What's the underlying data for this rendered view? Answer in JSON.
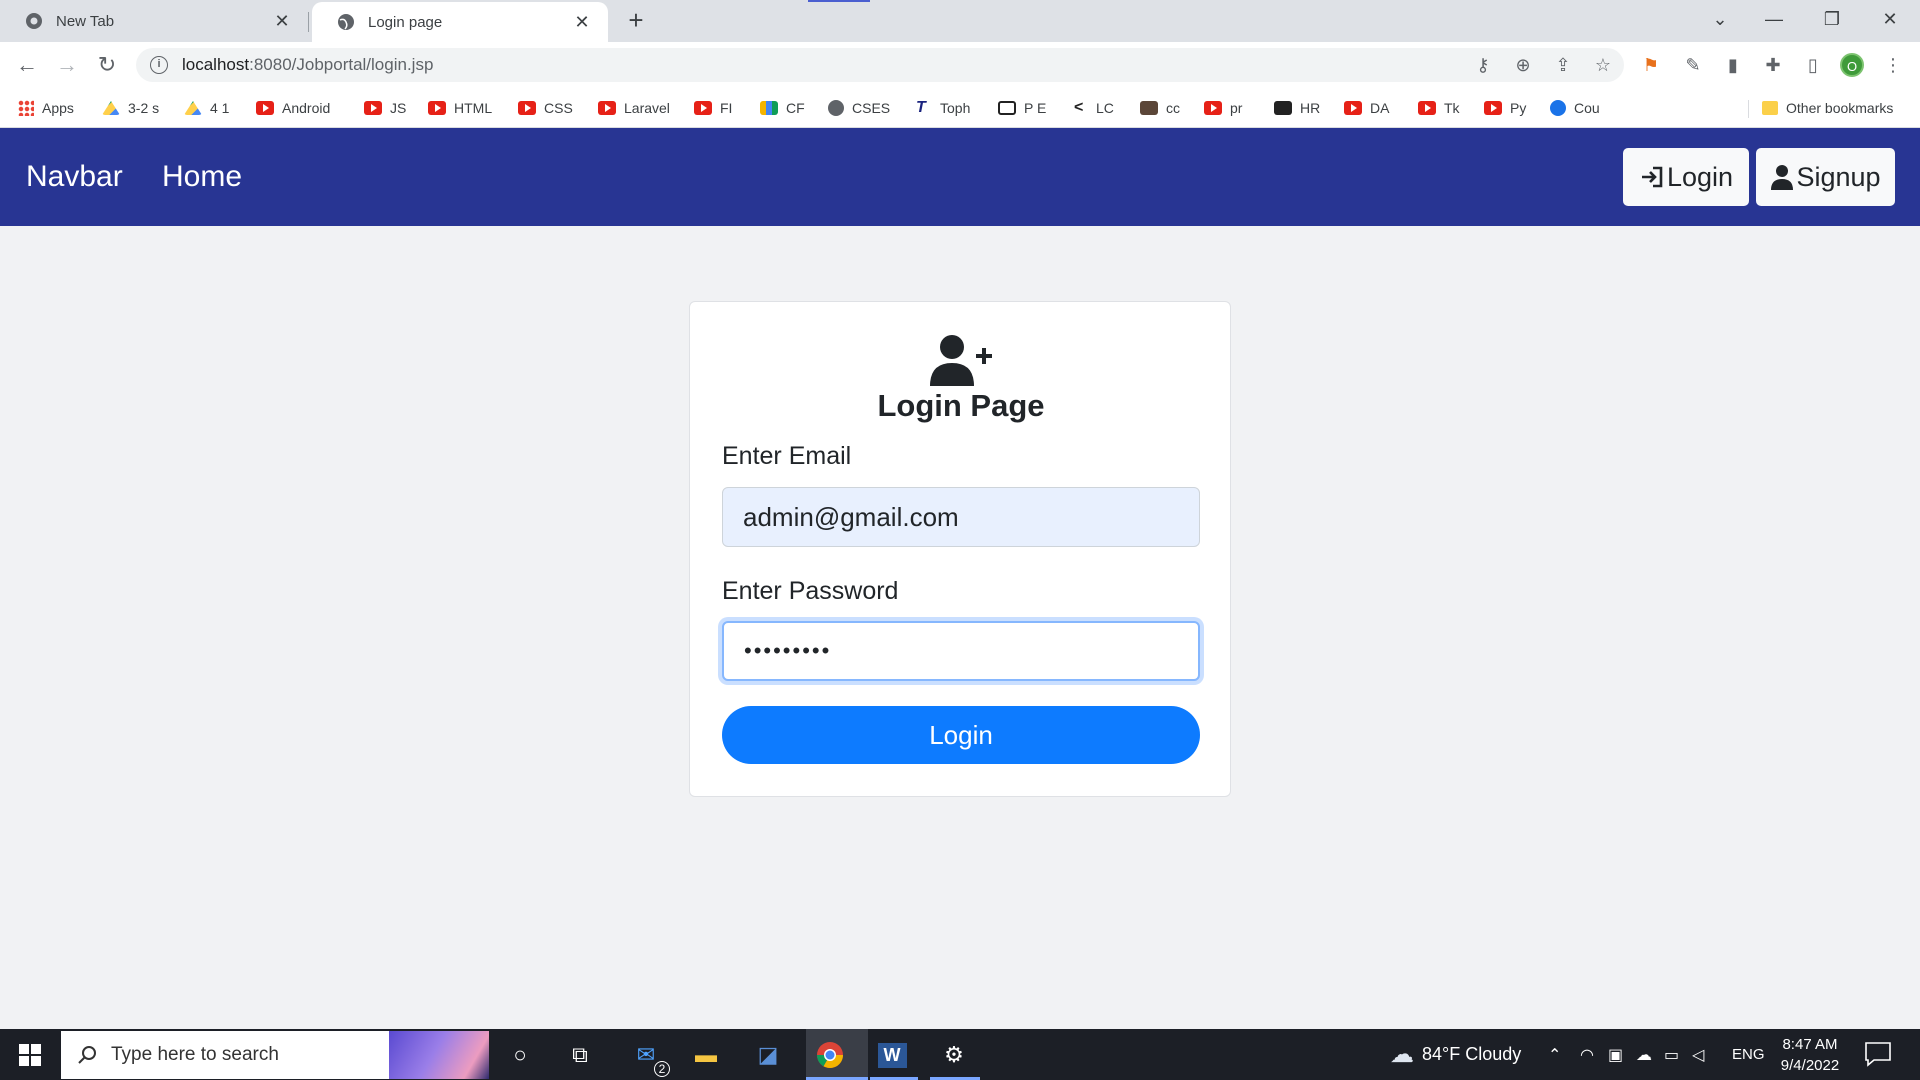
{
  "browser": {
    "tabs": [
      {
        "title": "New Tab",
        "active": false
      },
      {
        "title": "Login page",
        "active": true
      }
    ],
    "url_host": "localhost",
    "url_path": ":8080/Jobportal/login.jsp",
    "profile_initial": "O",
    "bookmarks": [
      {
        "label": "Apps",
        "icon": "apps-icon"
      },
      {
        "label": "3-2 s",
        "icon": "drive-icon"
      },
      {
        "label": "4 1",
        "icon": "drive-icon"
      },
      {
        "label": "Android",
        "icon": "youtube-icon"
      },
      {
        "label": "JS",
        "icon": "youtube-icon"
      },
      {
        "label": "HTML",
        "icon": "youtube-icon"
      },
      {
        "label": "CSS",
        "icon": "youtube-icon"
      },
      {
        "label": "Laravel",
        "icon": "youtube-icon"
      },
      {
        "label": "FI",
        "icon": "youtube-icon"
      },
      {
        "label": "CF",
        "icon": "chart-icon"
      },
      {
        "label": "CSES",
        "icon": "globe-icon"
      },
      {
        "label": "Toph",
        "icon": "toph-icon"
      },
      {
        "label": "P E",
        "icon": "pe-icon"
      },
      {
        "label": "LC",
        "icon": "leetcode-icon"
      },
      {
        "label": "cc",
        "icon": "codechef-icon"
      },
      {
        "label": "pr",
        "icon": "youtube-icon"
      },
      {
        "label": "HR",
        "icon": "hackerrank-icon"
      },
      {
        "label": "DA",
        "icon": "youtube-icon"
      },
      {
        "label": "Tk",
        "icon": "youtube-icon"
      },
      {
        "label": "Py",
        "icon": "youtube-icon"
      },
      {
        "label": "Cou",
        "icon": "coursera-icon"
      }
    ],
    "other_bookmarks": "Other bookmarks"
  },
  "page": {
    "navbar": {
      "brand": "Navbar",
      "home": "Home",
      "login_label": "Login",
      "signup_label": "Signup",
      "bg_color": "#283593"
    },
    "form": {
      "title": "Login Page",
      "email_label": "Enter Email",
      "email_value": "admin@gmail.com",
      "password_label": "Enter Password",
      "password_value": "•••••••••",
      "submit_label": "Login",
      "accent_color": "#0d7bff"
    }
  },
  "taskbar": {
    "search_placeholder": "Type here to search",
    "mail_badge": "2",
    "weather": "84°F  Cloudy",
    "language": "ENG",
    "time": "8:47 AM",
    "date": "9/4/2022"
  }
}
